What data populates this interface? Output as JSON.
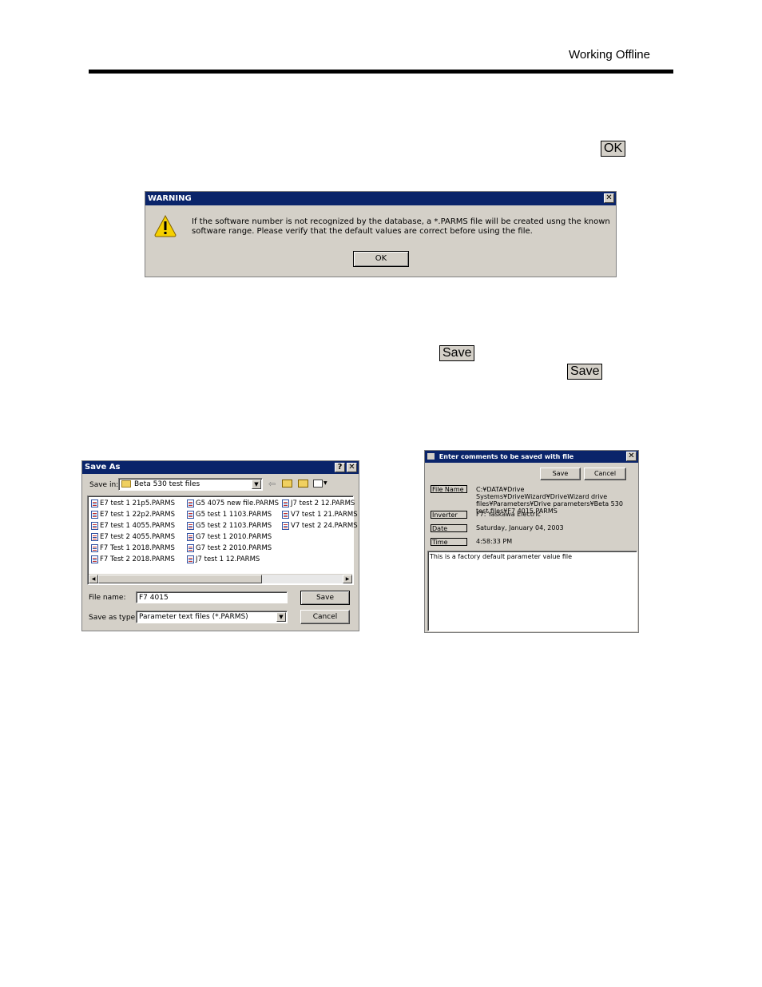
{
  "page": {
    "header": "Working Offline"
  },
  "inline_buttons": {
    "ok": "OK",
    "save1": "Save",
    "save2": "Save"
  },
  "warning": {
    "title": "WARNING",
    "close": "✕",
    "message": "If the software number is not recognized by the database, a *.PARMS file will be created usng the known software range. Please verify that the default values are correct before using the file.",
    "ok": "OK"
  },
  "save_as": {
    "title": "Save As",
    "help": "?",
    "close": "✕",
    "save_in_label": "Save in:",
    "save_in_value": "Beta 530 test files",
    "files": [
      "E7 test 1 21p5.PARMS",
      "E7 test 1 22p2.PARMS",
      "E7 test 1 4055.PARMS",
      "E7 test 2 4055.PARMS",
      "F7 Test 1 2018.PARMS",
      "F7 Test 2 2018.PARMS",
      "G5 4075 new file.PARMS",
      "G5 test 1 1103.PARMS",
      "G5 test 2 1103.PARMS",
      "G7 test 1 2010.PARMS",
      "G7 test 2 2010.PARMS",
      "J7 test 1 12.PARMS",
      "J7 test 2 12.PARMS",
      "V7 test 1 21.PARMS",
      "V7 test 2 24.PARMS"
    ],
    "file_name_label": "File name:",
    "file_name_value": "F7 4015",
    "save_type_label": "Save as type:",
    "save_type_value": "Parameter text files (*.PARMS)",
    "save_button": "Save",
    "cancel_button": "Cancel"
  },
  "comments": {
    "title": "Enter comments to be saved with file",
    "close": "✕",
    "save_button": "Save",
    "cancel_button": "Cancel",
    "file_name_label": "File Name",
    "file_name_value": "C:¥DATA¥Drive Systems¥DriveWizard¥DriveWizard drive files¥Parameters¥Drive parameters¥Beta 530 test files¥F7 4015.PARMS",
    "inverter_label": "Inverter",
    "inverter_value": "F7: Yaskawa Electric",
    "date_label": "Date",
    "date_value": "Saturday, January 04, 2003",
    "time_label": "Time",
    "time_value": "4:58:33 PM",
    "comment_text": "This is a factory default parameter value file"
  }
}
